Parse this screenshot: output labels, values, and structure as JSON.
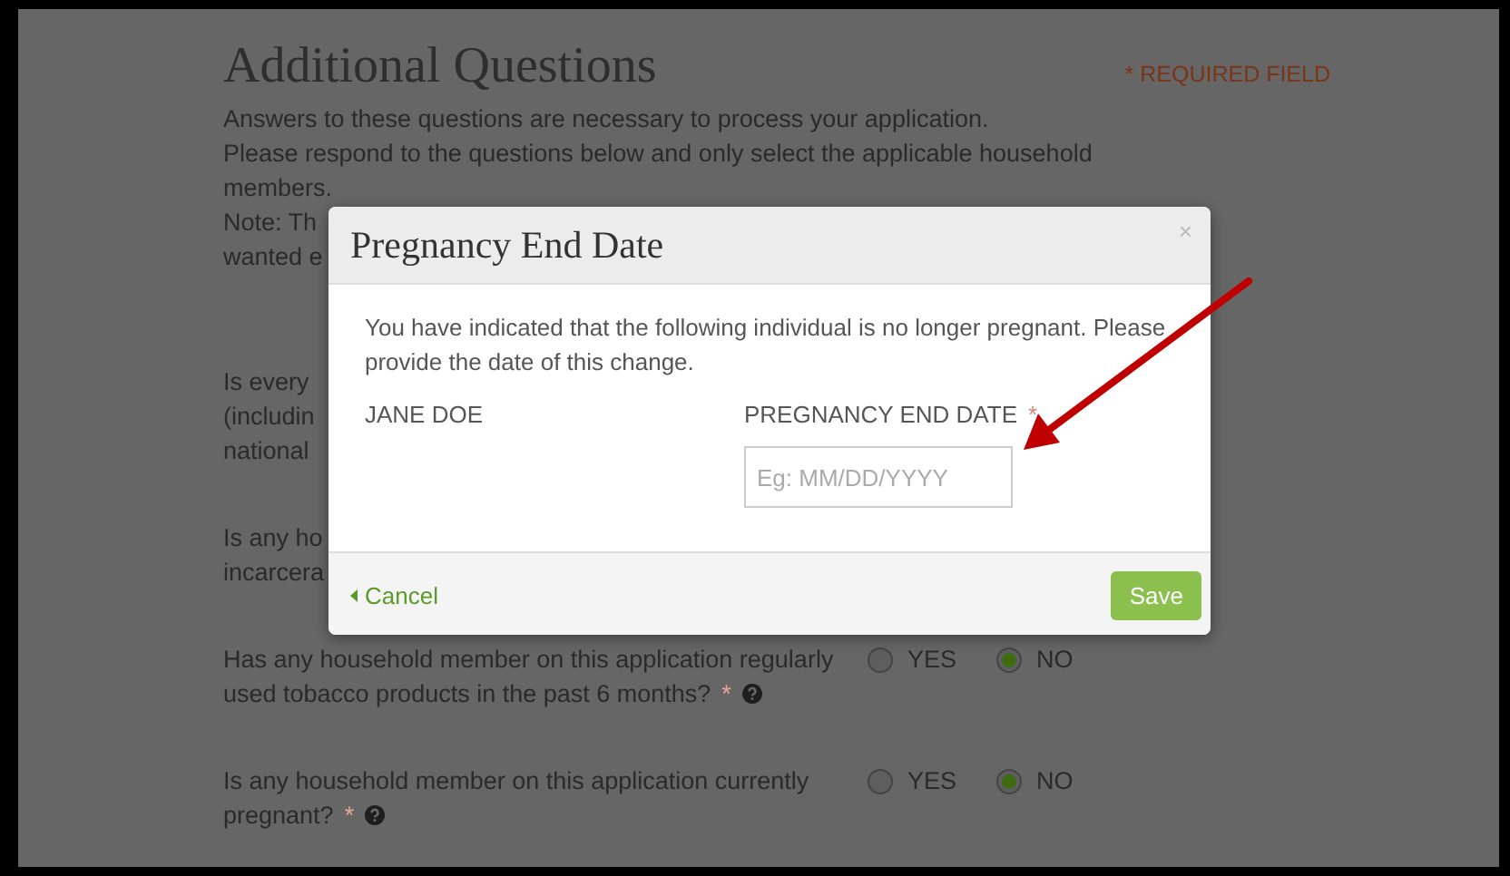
{
  "page": {
    "title": "Additional Questions",
    "required_note": "* REQUIRED FIELD",
    "intro_lines": [
      "Answers to these questions are necessary to process your application.",
      "Please respond to the questions below and only select the applicable household",
      "members.",
      "Note: Th",
      "wanted e"
    ],
    "questions": [
      {
        "lines": [
          "Is every",
          "(includin",
          "national"
        ]
      },
      {
        "lines": [
          "Is any ho",
          "incarcera"
        ]
      },
      {
        "lines": [
          "Has any household member on this application regularly",
          "used tobacco products in the past 6 months?"
        ],
        "required_mark": "*",
        "help_icon": true,
        "options": [
          {
            "label": "YES",
            "selected": false
          },
          {
            "label": "NO",
            "selected": true
          }
        ]
      },
      {
        "lines": [
          "Is any household member on this application currently",
          "pregnant?"
        ],
        "required_mark": "*",
        "help_icon": true,
        "options": [
          {
            "label": "YES",
            "selected": false
          },
          {
            "label": "NO",
            "selected": true
          }
        ]
      }
    ]
  },
  "dialog": {
    "title": "Pregnancy End Date",
    "close": "×",
    "message": "You have indicated that the following individual is no longer pregnant. Please provide the date of this change.",
    "person": "JANE DOE",
    "field_label": "PREGNANCY END DATE",
    "field_required": "*",
    "placeholder": "Eg: MM/DD/YYYY",
    "cancel": "Cancel",
    "save": "Save"
  }
}
